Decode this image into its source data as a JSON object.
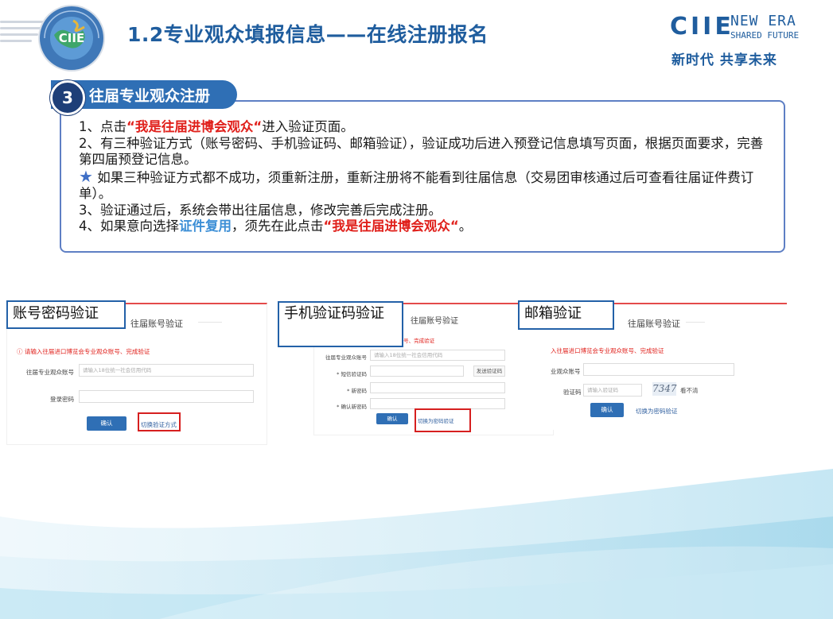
{
  "header": {
    "title": "1.2专业观众填报信息——在线注册报名",
    "logo_text": "CIIE",
    "logo_ring_text": "CHINA INTERNATIONAL IMPORT EXPO 中国国际进口博览会",
    "brand": {
      "name": "CIIE",
      "slogan_en_1": "NEW ERA",
      "slogan_en_2": "SHARED FUTURE",
      "slogan_cn": "新时代 共享未来"
    }
  },
  "section": {
    "number": "3",
    "title": "往届专业观众注册"
  },
  "content": {
    "line1_pre": "1、点击",
    "line1_red": "“我是往届进博会观众“",
    "line1_post": "进入验证页面。",
    "line2": "2、有三种验证方式（账号密码、手机验证码、邮箱验证），验证成功后进入预登记信息填写页面，根据页面要求，完善第四届预登记信息。",
    "star_icon": "★",
    "line3": "如果三种验证方式都不成功，须重新注册，重新注册将不能看到往届信息（交易团审核通过后可查看往届证件费订单）。",
    "line4": "3、验证通过后，系统会带出往届信息，修改完善后完成注册。",
    "line5_pre": "4、如果意向选择",
    "line5_blue": "证件复用",
    "line5_mid": "，须先在此点击",
    "line5_red": "“我是往届进博会观众“",
    "line5_post": "。"
  },
  "screens": {
    "account": {
      "tag": "账号密码验证",
      "title": "往届账号验证",
      "alert": "ⓘ 请输入往届进口博览会专业观众账号、完成验证",
      "account_label": "往届专业观众账号",
      "account_placeholder": "请输入18位统一社会信用代码",
      "password_label": "登录密码",
      "confirm": "确认",
      "switch_link": "切换验证方式"
    },
    "phone": {
      "tag": "手机验证码验证",
      "title": "往届账号验证",
      "alert": "ⓘ 请输入往届进口博览会专业观众账号、完成验证",
      "account_label": "往届专业观众账号",
      "account_placeholder": "请输入18位统一社会信用代码",
      "sms_label": "* 短信验证码",
      "send_button": "发送验证码",
      "new_password_label": "* 新密码",
      "confirm_password_label": "* 确认新密码",
      "confirm": "确认",
      "switch_link": "切换为密码验证"
    },
    "email": {
      "tag": "邮箱验证",
      "title": "往届账号验证",
      "alert": "入往届进口博览会专业观众账号、完成验证",
      "account_label": "业观众账号",
      "code_label": "验证码",
      "code_placeholder": "请输入验证码",
      "captcha": "7347",
      "captcha_refresh": "看不清",
      "confirm": "确认",
      "switch_link": "切换为密码验证"
    }
  }
}
